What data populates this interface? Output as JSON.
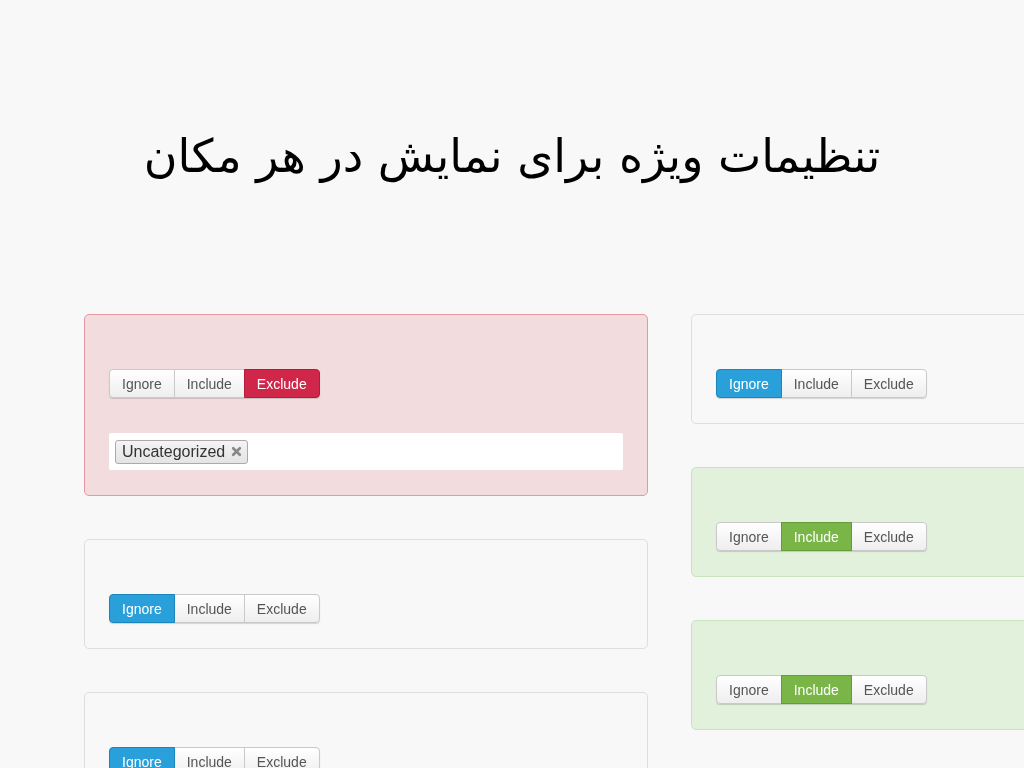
{
  "title": "تنظیمات ویژه برای نمایش در هر مکان",
  "columns": [
    {
      "cards": [
        {
          "options": [
            {
              "label": "Ignore",
              "selected": false
            },
            {
              "label": "Include",
              "selected": false
            },
            {
              "label": "Exclude",
              "selected": true
            }
          ],
          "tags": [
            {
              "label": "Uncategorized"
            }
          ]
        },
        {
          "options": [
            {
              "label": "Ignore",
              "selected": true
            },
            {
              "label": "Include",
              "selected": false
            },
            {
              "label": "Exclude",
              "selected": false
            }
          ]
        },
        {
          "options": [
            {
              "label": "Ignore",
              "selected": true
            },
            {
              "label": "Include",
              "selected": false
            },
            {
              "label": "Exclude",
              "selected": false
            }
          ]
        }
      ]
    },
    {
      "cards": [
        {
          "options": [
            {
              "label": "Ignore",
              "selected": true
            },
            {
              "label": "Include",
              "selected": false
            },
            {
              "label": "Exclude",
              "selected": false
            }
          ]
        },
        {
          "options": [
            {
              "label": "Ignore",
              "selected": false
            },
            {
              "label": "Include",
              "selected": true
            },
            {
              "label": "Exclude",
              "selected": false
            }
          ]
        },
        {
          "options": [
            {
              "label": "Ignore",
              "selected": false
            },
            {
              "label": "Include",
              "selected": true
            },
            {
              "label": "Exclude",
              "selected": false
            }
          ]
        }
      ]
    }
  ]
}
